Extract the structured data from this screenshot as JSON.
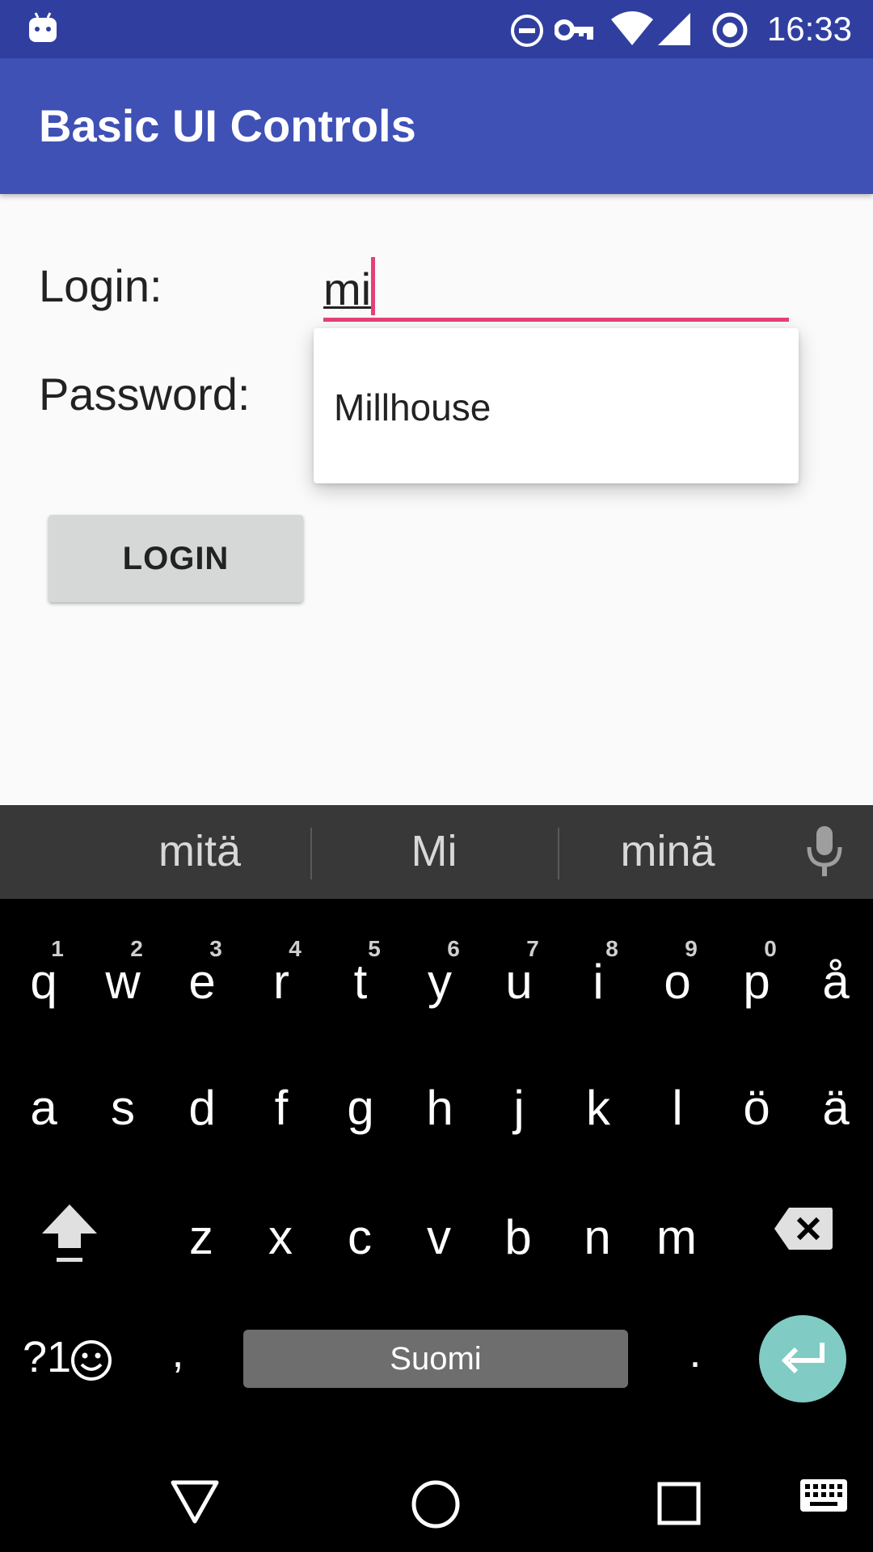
{
  "status_bar": {
    "time": "16:33",
    "icons": [
      "android-icon",
      "dnd-icon",
      "key-icon",
      "wifi-icon",
      "signal-icon",
      "sync-icon"
    ]
  },
  "app_bar": {
    "title": "Basic UI Controls"
  },
  "form": {
    "login_label": "Login:",
    "login_value": "mi",
    "password_label": "Password:",
    "login_button_label": "LOGIN"
  },
  "autocomplete": {
    "items": [
      "Millhouse"
    ]
  },
  "keyboard": {
    "suggestions": [
      "mitä",
      "Mi",
      "minä"
    ],
    "row1": [
      {
        "ch": "q",
        "hint": "1"
      },
      {
        "ch": "w",
        "hint": "2"
      },
      {
        "ch": "e",
        "hint": "3"
      },
      {
        "ch": "r",
        "hint": "4"
      },
      {
        "ch": "t",
        "hint": "5"
      },
      {
        "ch": "y",
        "hint": "6"
      },
      {
        "ch": "u",
        "hint": "7"
      },
      {
        "ch": "i",
        "hint": "8"
      },
      {
        "ch": "o",
        "hint": "9"
      },
      {
        "ch": "p",
        "hint": "0"
      },
      {
        "ch": "å",
        "hint": ""
      }
    ],
    "row2": [
      "a",
      "s",
      "d",
      "f",
      "g",
      "h",
      "j",
      "k",
      "l",
      "ö",
      "ä"
    ],
    "row3": [
      "z",
      "x",
      "c",
      "v",
      "b",
      "n",
      "m"
    ],
    "symbols_label": "?1",
    "comma": ",",
    "space_label": "Suomi",
    "period": "."
  },
  "colors": {
    "status_bar": "#303f9f",
    "app_bar": "#3f51b5",
    "accent": "#e5407a",
    "enter_key": "#80cbc4"
  }
}
